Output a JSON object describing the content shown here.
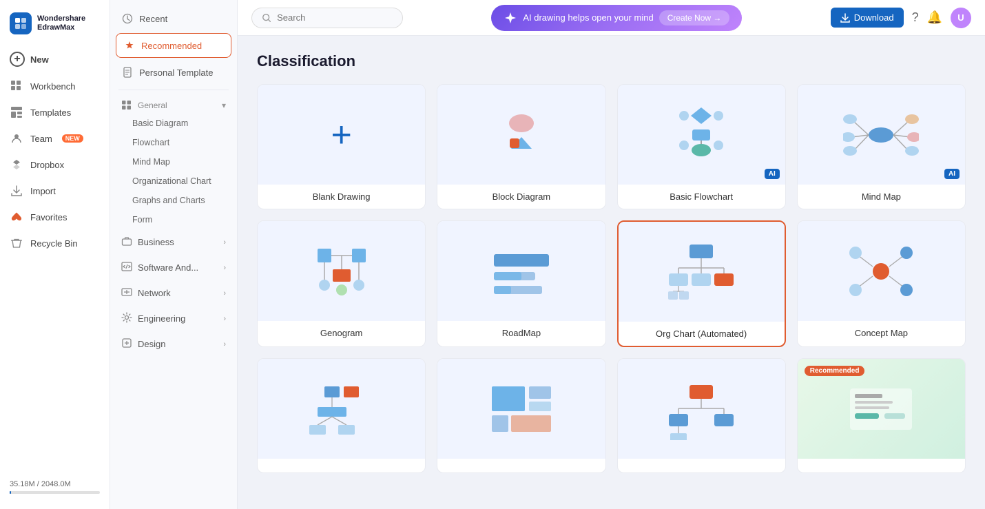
{
  "app": {
    "logo_line1": "Wondershare",
    "logo_line2": "EdrawMax"
  },
  "sidebar": {
    "items": [
      {
        "id": "new",
        "label": "New",
        "icon": "plus"
      },
      {
        "id": "workbench",
        "label": "Workbench",
        "icon": "grid"
      },
      {
        "id": "templates",
        "label": "Templates",
        "icon": "template"
      },
      {
        "id": "team",
        "label": "Team",
        "icon": "user",
        "badge": "NEW"
      },
      {
        "id": "dropbox",
        "label": "Dropbox",
        "icon": "box"
      },
      {
        "id": "import",
        "label": "Import",
        "icon": "import"
      },
      {
        "id": "favorites",
        "label": "Favorites",
        "icon": "heart"
      },
      {
        "id": "recycle",
        "label": "Recycle Bin",
        "icon": "trash"
      }
    ],
    "storage": {
      "used": "35.18M",
      "total": "2048.0M",
      "label": "35.18M / 2048.0M",
      "percent": 1.7
    }
  },
  "middle_panel": {
    "items": [
      {
        "id": "recent",
        "label": "Recent",
        "icon": "clock"
      },
      {
        "id": "recommended",
        "label": "Recommended",
        "icon": "star",
        "active": true
      },
      {
        "id": "personal_template",
        "label": "Personal Template",
        "icon": "file"
      },
      {
        "id": "general",
        "label": "General",
        "icon": "apps",
        "expandable": true,
        "expanded": true
      },
      {
        "id": "basic_diagram",
        "label": "Basic Diagram",
        "sub": true
      },
      {
        "id": "flowchart",
        "label": "Flowchart",
        "sub": true
      },
      {
        "id": "mind_map",
        "label": "Mind Map",
        "sub": true
      },
      {
        "id": "org_chart",
        "label": "Organizational Chart",
        "sub": true
      },
      {
        "id": "graphs_charts",
        "label": "Graphs and Charts",
        "sub": true
      },
      {
        "id": "form",
        "label": "Form",
        "sub": true
      },
      {
        "id": "business",
        "label": "Business",
        "icon": "briefcase",
        "expandable": true
      },
      {
        "id": "software",
        "label": "Software And...",
        "icon": "code",
        "expandable": true
      },
      {
        "id": "network",
        "label": "Network",
        "icon": "network",
        "expandable": true
      },
      {
        "id": "engineering",
        "label": "Engineering",
        "icon": "gear",
        "expandable": true
      },
      {
        "id": "design",
        "label": "Design",
        "icon": "pen",
        "expandable": true
      }
    ]
  },
  "topbar": {
    "search_placeholder": "Search",
    "ai_banner_text": "AI drawing helps open your mind",
    "ai_create_label": "Create Now →",
    "download_label": "Download"
  },
  "main": {
    "section_title": "Classification",
    "cards": [
      {
        "id": "blank",
        "label": "Blank Drawing",
        "thumb": "blank",
        "ai": false,
        "selected": false,
        "recommended": false
      },
      {
        "id": "block",
        "label": "Block Diagram",
        "thumb": "block",
        "ai": false,
        "selected": false,
        "recommended": false
      },
      {
        "id": "flowchart",
        "label": "Basic Flowchart",
        "thumb": "flowchart",
        "ai": true,
        "selected": false,
        "recommended": false
      },
      {
        "id": "mindmap",
        "label": "Mind Map",
        "thumb": "mindmap",
        "ai": true,
        "selected": false,
        "recommended": false
      },
      {
        "id": "genogram",
        "label": "Genogram",
        "thumb": "genogram",
        "ai": false,
        "selected": false,
        "recommended": false
      },
      {
        "id": "roadmap",
        "label": "RoadMap",
        "thumb": "roadmap",
        "ai": false,
        "selected": false,
        "recommended": false
      },
      {
        "id": "orgchart",
        "label": "Org Chart (Automated)",
        "thumb": "orgchart",
        "ai": false,
        "selected": true,
        "recommended": false
      },
      {
        "id": "conceptmap",
        "label": "Concept Map",
        "thumb": "conceptmap",
        "ai": false,
        "selected": false,
        "recommended": false
      },
      {
        "id": "network1",
        "label": "",
        "thumb": "network1",
        "ai": false,
        "selected": false,
        "recommended": false
      },
      {
        "id": "treemap",
        "label": "",
        "thumb": "treemap",
        "ai": false,
        "selected": false,
        "recommended": false
      },
      {
        "id": "hierarchy",
        "label": "",
        "thumb": "hierarchy",
        "ai": false,
        "selected": false,
        "recommended": false
      },
      {
        "id": "recommended_card",
        "label": "",
        "thumb": "recommended_card",
        "ai": false,
        "selected": false,
        "recommended": true
      }
    ]
  }
}
